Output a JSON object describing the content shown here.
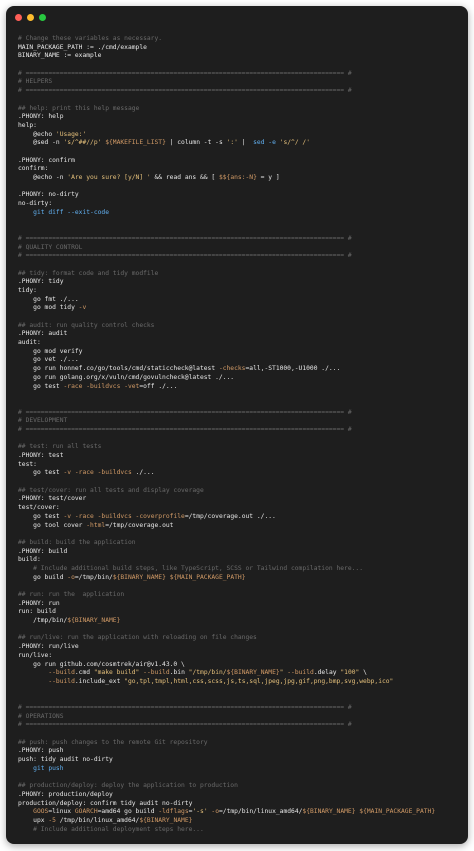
{
  "window": {
    "controls": [
      "close",
      "minimize",
      "maximize"
    ],
    "colors": {
      "background": "#1e1e1e",
      "close": "#ff5f57",
      "minimize": "#febc2e",
      "maximize": "#28c840"
    }
  },
  "code_lines": [
    [
      {
        "t": "# Change these variables as necessary.",
        "c": "c"
      }
    ],
    [
      {
        "t": "MAIN_PACKAGE_PATH := ./cmd/example",
        "c": "k"
      }
    ],
    [
      {
        "t": "BINARY_NAME := example",
        "c": "k"
      }
    ],
    [],
    [
      {
        "t": "# ==================================================================================== #",
        "c": "c"
      }
    ],
    [
      {
        "t": "# HELPERS",
        "c": "c"
      }
    ],
    [
      {
        "t": "# ==================================================================================== #",
        "c": "c"
      }
    ],
    [],
    [
      {
        "t": "## help: print this help message",
        "c": "c"
      }
    ],
    [
      {
        "t": ".PHONY: help",
        "c": "k"
      }
    ],
    [
      {
        "t": "help:",
        "c": "k"
      }
    ],
    [
      {
        "t": "    @echo ",
        "c": "k"
      },
      {
        "t": "'Usage:'",
        "c": "s"
      }
    ],
    [
      {
        "t": "    @sed -n ",
        "c": "k"
      },
      {
        "t": "'s/^##//p'",
        "c": "s"
      },
      {
        "t": " ",
        "c": "k"
      },
      {
        "t": "${MAKEFILE_LIST}",
        "c": "v"
      },
      {
        "t": " | column -t -s ",
        "c": "k"
      },
      {
        "t": "':'",
        "c": "s"
      },
      {
        "t": " |  ",
        "c": "k"
      },
      {
        "t": "sed -e ",
        "c": "g"
      },
      {
        "t": "'s/^/ /'",
        "c": "s"
      }
    ],
    [],
    [
      {
        "t": ".PHONY: confirm",
        "c": "k"
      }
    ],
    [
      {
        "t": "confirm:",
        "c": "k"
      }
    ],
    [
      {
        "t": "    @echo -n ",
        "c": "k"
      },
      {
        "t": "'Are you sure? [y/N] '",
        "c": "s"
      },
      {
        "t": " && read ans && [ ",
        "c": "k"
      },
      {
        "t": "$${ans:-N}",
        "c": "v"
      },
      {
        "t": " = y ]",
        "c": "k"
      }
    ],
    [],
    [
      {
        "t": ".PHONY: no-dirty",
        "c": "k"
      }
    ],
    [
      {
        "t": "no-dirty:",
        "c": "k"
      }
    ],
    [
      {
        "t": "    git diff --exit-code",
        "c": "g"
      }
    ],
    [],
    [],
    [
      {
        "t": "# ==================================================================================== #",
        "c": "c"
      }
    ],
    [
      {
        "t": "# QUALITY CONTROL",
        "c": "c"
      }
    ],
    [
      {
        "t": "# ==================================================================================== #",
        "c": "c"
      }
    ],
    [],
    [
      {
        "t": "## tidy: format code and tidy modfile",
        "c": "c"
      }
    ],
    [
      {
        "t": ".PHONY: tidy",
        "c": "k"
      }
    ],
    [
      {
        "t": "tidy:",
        "c": "k"
      }
    ],
    [
      {
        "t": "    go fmt ./...",
        "c": "k"
      }
    ],
    [
      {
        "t": "    go mod tidy ",
        "c": "k"
      },
      {
        "t": "-v",
        "c": "v"
      }
    ],
    [],
    [
      {
        "t": "## audit: run quality control checks",
        "c": "c"
      }
    ],
    [
      {
        "t": ".PHONY: audit",
        "c": "k"
      }
    ],
    [
      {
        "t": "audit:",
        "c": "k"
      }
    ],
    [
      {
        "t": "    go mod verify",
        "c": "k"
      }
    ],
    [
      {
        "t": "    go vet ./...",
        "c": "k"
      }
    ],
    [
      {
        "t": "    go run honnef.co/go/tools/cmd/staticcheck@latest ",
        "c": "k"
      },
      {
        "t": "-checks",
        "c": "v"
      },
      {
        "t": "=all,-ST1000,-U1000 ./...",
        "c": "k"
      }
    ],
    [
      {
        "t": "    go run golang.org/x/vuln/cmd/govulncheck@latest ./...",
        "c": "k"
      }
    ],
    [
      {
        "t": "    go test ",
        "c": "k"
      },
      {
        "t": "-race",
        "c": "v"
      },
      {
        "t": " ",
        "c": "k"
      },
      {
        "t": "-buildvcs",
        "c": "v"
      },
      {
        "t": " ",
        "c": "k"
      },
      {
        "t": "-vet",
        "c": "v"
      },
      {
        "t": "=off ./...",
        "c": "k"
      }
    ],
    [],
    [],
    [
      {
        "t": "# ==================================================================================== #",
        "c": "c"
      }
    ],
    [
      {
        "t": "# DEVELOPMENT",
        "c": "c"
      }
    ],
    [
      {
        "t": "# ==================================================================================== #",
        "c": "c"
      }
    ],
    [],
    [
      {
        "t": "## test: run all tests",
        "c": "c"
      }
    ],
    [
      {
        "t": ".PHONY: test",
        "c": "k"
      }
    ],
    [
      {
        "t": "test:",
        "c": "k"
      }
    ],
    [
      {
        "t": "    go test ",
        "c": "k"
      },
      {
        "t": "-v -race -buildvcs",
        "c": "v"
      },
      {
        "t": " ./...",
        "c": "k"
      }
    ],
    [],
    [
      {
        "t": "## test/cover: run all tests and display coverage",
        "c": "c"
      }
    ],
    [
      {
        "t": ".PHONY: test/cover",
        "c": "k"
      }
    ],
    [
      {
        "t": "test/cover:",
        "c": "k"
      }
    ],
    [
      {
        "t": "    go test ",
        "c": "k"
      },
      {
        "t": "-v -race -buildvcs -coverprofile",
        "c": "v"
      },
      {
        "t": "=/tmp/coverage.out ./...",
        "c": "k"
      }
    ],
    [
      {
        "t": "    go tool cover ",
        "c": "k"
      },
      {
        "t": "-html",
        "c": "v"
      },
      {
        "t": "=/tmp/coverage.out",
        "c": "k"
      }
    ],
    [],
    [
      {
        "t": "## build: build the application",
        "c": "c"
      }
    ],
    [
      {
        "t": ".PHONY: build",
        "c": "k"
      }
    ],
    [
      {
        "t": "build:",
        "c": "k"
      }
    ],
    [
      {
        "t": "    # Include additional build steps, like TypeScript, SCSS or Tailwind compilation here...",
        "c": "c"
      }
    ],
    [
      {
        "t": "    go build ",
        "c": "k"
      },
      {
        "t": "-o",
        "c": "v"
      },
      {
        "t": "=/tmp/bin/",
        "c": "k"
      },
      {
        "t": "${BINARY_NAME}",
        "c": "v"
      },
      {
        "t": " ",
        "c": "k"
      },
      {
        "t": "${MAIN_PACKAGE_PATH}",
        "c": "v"
      }
    ],
    [],
    [
      {
        "t": "## run: run the  application",
        "c": "c"
      }
    ],
    [
      {
        "t": ".PHONY: run",
        "c": "k"
      }
    ],
    [
      {
        "t": "run: build",
        "c": "k"
      }
    ],
    [
      {
        "t": "    /tmp/bin/",
        "c": "k"
      },
      {
        "t": "${BINARY_NAME}",
        "c": "v"
      }
    ],
    [],
    [
      {
        "t": "## run/live: run the application with reloading on file changes",
        "c": "c"
      }
    ],
    [
      {
        "t": ".PHONY: run/live",
        "c": "k"
      }
    ],
    [
      {
        "t": "run/live:",
        "c": "k"
      }
    ],
    [
      {
        "t": "    go run github.com/cosmtrek/air@v1.43.0 \\",
        "c": "k"
      }
    ],
    [
      {
        "t": "        ",
        "c": "k"
      },
      {
        "t": "--build",
        "c": "v"
      },
      {
        "t": ".cmd ",
        "c": "k"
      },
      {
        "t": "\"make build\"",
        "c": "s"
      },
      {
        "t": " ",
        "c": "k"
      },
      {
        "t": "--build",
        "c": "v"
      },
      {
        "t": ".bin ",
        "c": "k"
      },
      {
        "t": "\"/tmp/bin/",
        "c": "s"
      },
      {
        "t": "${BINARY_NAME}",
        "c": "v"
      },
      {
        "t": "\"",
        "c": "s"
      },
      {
        "t": " ",
        "c": "k"
      },
      {
        "t": "--build",
        "c": "v"
      },
      {
        "t": ".delay ",
        "c": "k"
      },
      {
        "t": "\"100\"",
        "c": "s"
      },
      {
        "t": " \\",
        "c": "k"
      }
    ],
    [
      {
        "t": "        ",
        "c": "k"
      },
      {
        "t": "--build",
        "c": "v"
      },
      {
        "t": ".include_ext ",
        "c": "k"
      },
      {
        "t": "\"go,tpl,tmpl,html,css,scss,js,ts,sql,jpeg,jpg,gif,png,bmp,svg,webp,ico\"",
        "c": "s"
      }
    ],
    [],
    [],
    [
      {
        "t": "# ==================================================================================== #",
        "c": "c"
      }
    ],
    [
      {
        "t": "# OPERATIONS",
        "c": "c"
      }
    ],
    [
      {
        "t": "# ==================================================================================== #",
        "c": "c"
      }
    ],
    [],
    [
      {
        "t": "## push: push changes to the remote Git repository",
        "c": "c"
      }
    ],
    [
      {
        "t": ".PHONY: push",
        "c": "k"
      }
    ],
    [
      {
        "t": "push: tidy audit no-dirty",
        "c": "k"
      }
    ],
    [
      {
        "t": "    git push",
        "c": "g"
      }
    ],
    [],
    [
      {
        "t": "## production/deploy: deploy the application to production",
        "c": "c"
      }
    ],
    [
      {
        "t": ".PHONY: production/deploy",
        "c": "k"
      }
    ],
    [
      {
        "t": "production/deploy: confirm tidy audit no-dirty",
        "c": "k"
      }
    ],
    [
      {
        "t": "    GOOS",
        "c": "v"
      },
      {
        "t": "=linux ",
        "c": "k"
      },
      {
        "t": "GOARCH",
        "c": "v"
      },
      {
        "t": "=amd64 go build ",
        "c": "k"
      },
      {
        "t": "-ldflags",
        "c": "v"
      },
      {
        "t": "=",
        "c": "k"
      },
      {
        "t": "'-s'",
        "c": "s"
      },
      {
        "t": " ",
        "c": "k"
      },
      {
        "t": "-o",
        "c": "v"
      },
      {
        "t": "=/tmp/bin/linux_amd64/",
        "c": "k"
      },
      {
        "t": "${BINARY_NAME}",
        "c": "v"
      },
      {
        "t": " ",
        "c": "k"
      },
      {
        "t": "${MAIN_PACKAGE_PATH}",
        "c": "v"
      }
    ],
    [
      {
        "t": "    upx ",
        "c": "k"
      },
      {
        "t": "-5",
        "c": "v"
      },
      {
        "t": " /tmp/bin/linux_amd64/",
        "c": "k"
      },
      {
        "t": "${BINARY_NAME}",
        "c": "v"
      }
    ],
    [
      {
        "t": "    # Include additional deployment steps here...",
        "c": "c"
      }
    ]
  ]
}
